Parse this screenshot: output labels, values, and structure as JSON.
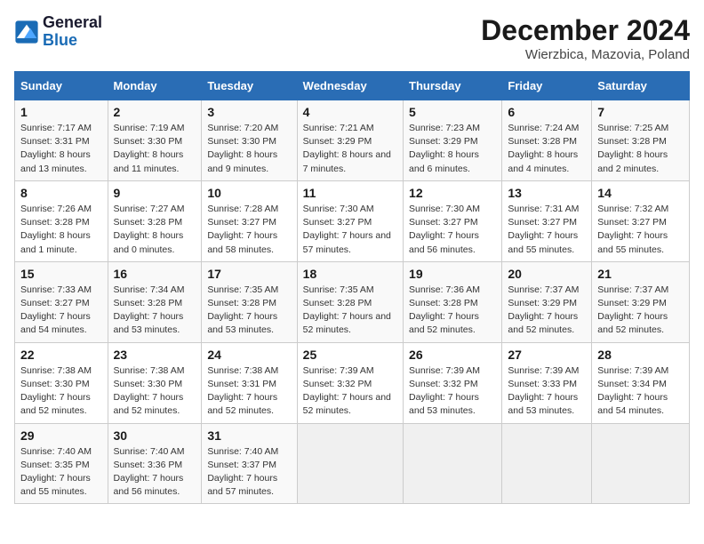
{
  "logo": {
    "text_general": "General",
    "text_blue": "Blue"
  },
  "header": {
    "title": "December 2024",
    "subtitle": "Wierzbica, Mazovia, Poland"
  },
  "weekdays": [
    "Sunday",
    "Monday",
    "Tuesday",
    "Wednesday",
    "Thursday",
    "Friday",
    "Saturday"
  ],
  "weeks": [
    [
      {
        "day": "1",
        "sunrise": "7:17 AM",
        "sunset": "3:31 PM",
        "daylight": "8 hours and 13 minutes."
      },
      {
        "day": "2",
        "sunrise": "7:19 AM",
        "sunset": "3:30 PM",
        "daylight": "8 hours and 11 minutes."
      },
      {
        "day": "3",
        "sunrise": "7:20 AM",
        "sunset": "3:30 PM",
        "daylight": "8 hours and 9 minutes."
      },
      {
        "day": "4",
        "sunrise": "7:21 AM",
        "sunset": "3:29 PM",
        "daylight": "8 hours and 7 minutes."
      },
      {
        "day": "5",
        "sunrise": "7:23 AM",
        "sunset": "3:29 PM",
        "daylight": "8 hours and 6 minutes."
      },
      {
        "day": "6",
        "sunrise": "7:24 AM",
        "sunset": "3:28 PM",
        "daylight": "8 hours and 4 minutes."
      },
      {
        "day": "7",
        "sunrise": "7:25 AM",
        "sunset": "3:28 PM",
        "daylight": "8 hours and 2 minutes."
      }
    ],
    [
      {
        "day": "8",
        "sunrise": "7:26 AM",
        "sunset": "3:28 PM",
        "daylight": "8 hours and 1 minute."
      },
      {
        "day": "9",
        "sunrise": "7:27 AM",
        "sunset": "3:28 PM",
        "daylight": "8 hours and 0 minutes."
      },
      {
        "day": "10",
        "sunrise": "7:28 AM",
        "sunset": "3:27 PM",
        "daylight": "7 hours and 58 minutes."
      },
      {
        "day": "11",
        "sunrise": "7:30 AM",
        "sunset": "3:27 PM",
        "daylight": "7 hours and 57 minutes."
      },
      {
        "day": "12",
        "sunrise": "7:30 AM",
        "sunset": "3:27 PM",
        "daylight": "7 hours and 56 minutes."
      },
      {
        "day": "13",
        "sunrise": "7:31 AM",
        "sunset": "3:27 PM",
        "daylight": "7 hours and 55 minutes."
      },
      {
        "day": "14",
        "sunrise": "7:32 AM",
        "sunset": "3:27 PM",
        "daylight": "7 hours and 55 minutes."
      }
    ],
    [
      {
        "day": "15",
        "sunrise": "7:33 AM",
        "sunset": "3:27 PM",
        "daylight": "7 hours and 54 minutes."
      },
      {
        "day": "16",
        "sunrise": "7:34 AM",
        "sunset": "3:28 PM",
        "daylight": "7 hours and 53 minutes."
      },
      {
        "day": "17",
        "sunrise": "7:35 AM",
        "sunset": "3:28 PM",
        "daylight": "7 hours and 53 minutes."
      },
      {
        "day": "18",
        "sunrise": "7:35 AM",
        "sunset": "3:28 PM",
        "daylight": "7 hours and 52 minutes."
      },
      {
        "day": "19",
        "sunrise": "7:36 AM",
        "sunset": "3:28 PM",
        "daylight": "7 hours and 52 minutes."
      },
      {
        "day": "20",
        "sunrise": "7:37 AM",
        "sunset": "3:29 PM",
        "daylight": "7 hours and 52 minutes."
      },
      {
        "day": "21",
        "sunrise": "7:37 AM",
        "sunset": "3:29 PM",
        "daylight": "7 hours and 52 minutes."
      }
    ],
    [
      {
        "day": "22",
        "sunrise": "7:38 AM",
        "sunset": "3:30 PM",
        "daylight": "7 hours and 52 minutes."
      },
      {
        "day": "23",
        "sunrise": "7:38 AM",
        "sunset": "3:30 PM",
        "daylight": "7 hours and 52 minutes."
      },
      {
        "day": "24",
        "sunrise": "7:38 AM",
        "sunset": "3:31 PM",
        "daylight": "7 hours and 52 minutes."
      },
      {
        "day": "25",
        "sunrise": "7:39 AM",
        "sunset": "3:32 PM",
        "daylight": "7 hours and 52 minutes."
      },
      {
        "day": "26",
        "sunrise": "7:39 AM",
        "sunset": "3:32 PM",
        "daylight": "7 hours and 53 minutes."
      },
      {
        "day": "27",
        "sunrise": "7:39 AM",
        "sunset": "3:33 PM",
        "daylight": "7 hours and 53 minutes."
      },
      {
        "day": "28",
        "sunrise": "7:39 AM",
        "sunset": "3:34 PM",
        "daylight": "7 hours and 54 minutes."
      }
    ],
    [
      {
        "day": "29",
        "sunrise": "7:40 AM",
        "sunset": "3:35 PM",
        "daylight": "7 hours and 55 minutes."
      },
      {
        "day": "30",
        "sunrise": "7:40 AM",
        "sunset": "3:36 PM",
        "daylight": "7 hours and 56 minutes."
      },
      {
        "day": "31",
        "sunrise": "7:40 AM",
        "sunset": "3:37 PM",
        "daylight": "7 hours and 57 minutes."
      },
      null,
      null,
      null,
      null
    ]
  ]
}
